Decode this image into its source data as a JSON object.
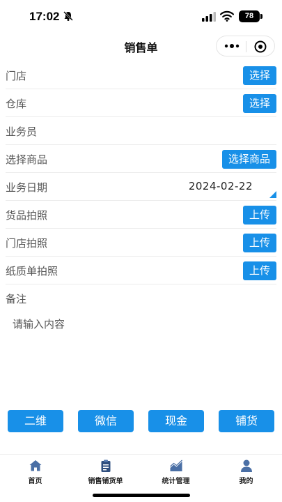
{
  "status_bar": {
    "time": "17:02",
    "battery": "78"
  },
  "nav": {
    "title": "销售单"
  },
  "form": {
    "rows": [
      {
        "label": "门店",
        "button": "选择"
      },
      {
        "label": "仓库",
        "button": "选择"
      },
      {
        "label": "业务员"
      },
      {
        "label": "选择商品",
        "button": "选择商品"
      },
      {
        "label": "业务日期",
        "value": "2024-02-22"
      },
      {
        "label": "货品拍照",
        "button": "上传"
      },
      {
        "label": "门店拍照",
        "button": "上传"
      },
      {
        "label": "纸质单拍照",
        "button": "上传"
      },
      {
        "label": "备注"
      }
    ],
    "remark_placeholder": "请输入内容"
  },
  "payment_buttons": [
    "二维",
    "微信",
    "现金",
    "铺货"
  ],
  "tabs": [
    {
      "label": "首页",
      "icon": "home-icon"
    },
    {
      "label": "销售铺货单",
      "icon": "clipboard-icon"
    },
    {
      "label": "统计管理",
      "icon": "chart-icon"
    },
    {
      "label": "我的",
      "icon": "user-icon"
    }
  ],
  "colors": {
    "accent": "#1890e8",
    "tab_icon": "#4a6fa5"
  }
}
